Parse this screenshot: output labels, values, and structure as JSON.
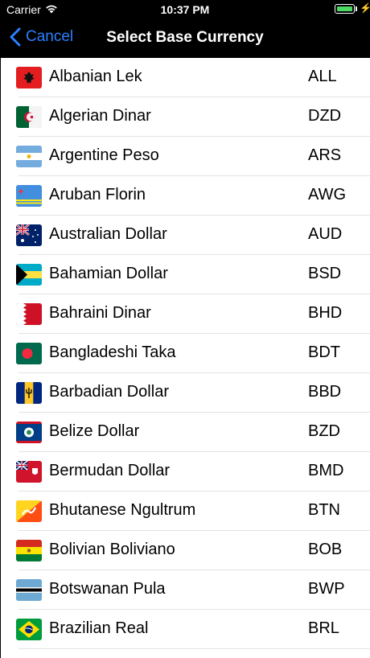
{
  "status_bar": {
    "carrier": "Carrier",
    "time": "10:37 PM",
    "battery_color": "#4cd964"
  },
  "nav": {
    "back_label": "Cancel",
    "title": "Select Base Currency",
    "accent": "#2b80ff"
  },
  "currencies": [
    {
      "name": "Albanian Lek",
      "code": "ALL",
      "flag": "albania-flag"
    },
    {
      "name": "Algerian Dinar",
      "code": "DZD",
      "flag": "algeria-flag"
    },
    {
      "name": "Argentine Peso",
      "code": "ARS",
      "flag": "argentina-flag"
    },
    {
      "name": "Aruban Florin",
      "code": "AWG",
      "flag": "aruba-flag"
    },
    {
      "name": "Australian Dollar",
      "code": "AUD",
      "flag": "australia-flag"
    },
    {
      "name": "Bahamian Dollar",
      "code": "BSD",
      "flag": "bahamas-flag"
    },
    {
      "name": "Bahraini Dinar",
      "code": "BHD",
      "flag": "bahrain-flag"
    },
    {
      "name": "Bangladeshi Taka",
      "code": "BDT",
      "flag": "bangladesh-flag"
    },
    {
      "name": "Barbadian Dollar",
      "code": "BBD",
      "flag": "barbados-flag"
    },
    {
      "name": "Belize Dollar",
      "code": "BZD",
      "flag": "belize-flag"
    },
    {
      "name": "Bermudan Dollar",
      "code": "BMD",
      "flag": "bermuda-flag"
    },
    {
      "name": "Bhutanese Ngultrum",
      "code": "BTN",
      "flag": "bhutan-flag"
    },
    {
      "name": "Bolivian Boliviano",
      "code": "BOB",
      "flag": "bolivia-flag"
    },
    {
      "name": "Botswanan Pula",
      "code": "BWP",
      "flag": "botswana-flag"
    },
    {
      "name": "Brazilian Real",
      "code": "BRL",
      "flag": "brazil-flag"
    }
  ]
}
